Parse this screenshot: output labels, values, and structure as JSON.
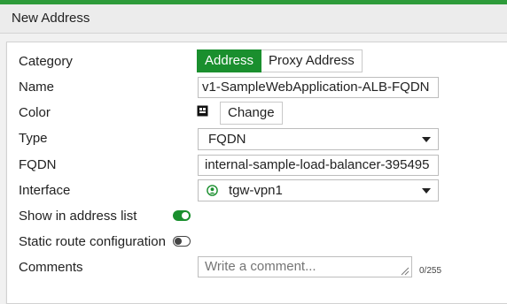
{
  "header": {
    "title": "New Address"
  },
  "form": {
    "category": {
      "label": "Category",
      "options": [
        "Address",
        "Proxy Address"
      ],
      "selected": "Address"
    },
    "name": {
      "label": "Name",
      "value": "v1-SampleWebApplication-ALB-FQDN",
      "visible_text": ":v1-SampleWebApplication-ALB-FQDN"
    },
    "color": {
      "label": "Color",
      "change_label": "Change"
    },
    "type": {
      "label": "Type",
      "value": "FQDN"
    },
    "fqdn": {
      "label": "FQDN",
      "value": "internal-sample-load-balancer-395495"
    },
    "interface": {
      "label": "Interface",
      "value": "tgw-vpn1",
      "icon": "user-circle-icon"
    },
    "show_in_address_list": {
      "label": "Show in address list",
      "enabled": true
    },
    "static_route": {
      "label": "Static route configuration",
      "enabled": false
    },
    "comments": {
      "label": "Comments",
      "placeholder": "Write a comment...",
      "counter": "0/255"
    }
  },
  "colors": {
    "accent": "#1a8f2e",
    "topbar": "#2e9b3a"
  }
}
